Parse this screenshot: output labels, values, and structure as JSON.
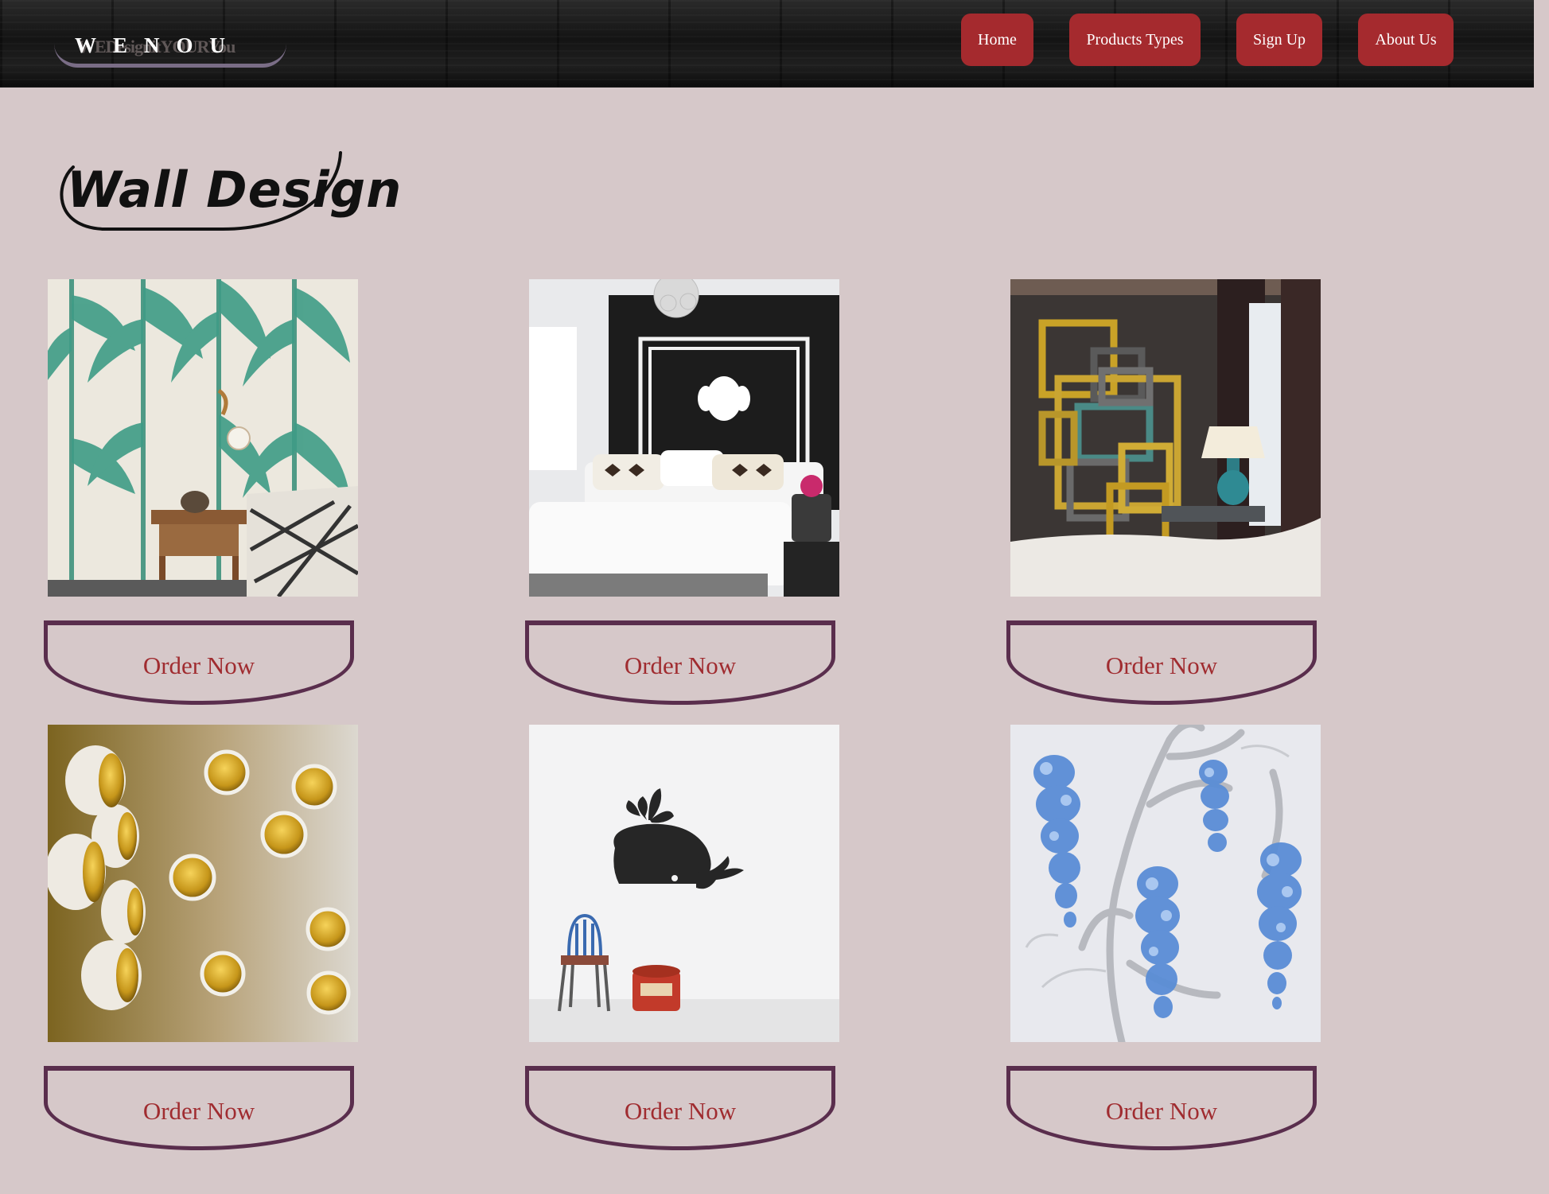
{
  "header": {
    "logo_text": "WENOU",
    "logo_ghost_text": "WEDesignitYOURYou",
    "nav": [
      {
        "label": "Home"
      },
      {
        "label": "Products Types"
      },
      {
        "label": "Sign Up"
      },
      {
        "label": "About Us"
      }
    ]
  },
  "page": {
    "title": "Wall Design"
  },
  "products": [
    {
      "image": "palm-leaf-wallpaper",
      "button_label": "Order Now"
    },
    {
      "image": "black-accent-wall-bedroom",
      "button_label": "Order Now"
    },
    {
      "image": "gold-frames-wall",
      "button_label": "Order Now"
    },
    {
      "image": "gold-bowls-wall-art",
      "button_label": "Order Now"
    },
    {
      "image": "whale-wall-decal",
      "button_label": "Order Now"
    },
    {
      "image": "wisteria-wallpaper",
      "button_label": "Order Now"
    }
  ],
  "colors": {
    "background": "#d6c8c9",
    "nav_button": "#a52a2e",
    "order_border": "#5a2e4d",
    "order_text": "#a02c30"
  }
}
